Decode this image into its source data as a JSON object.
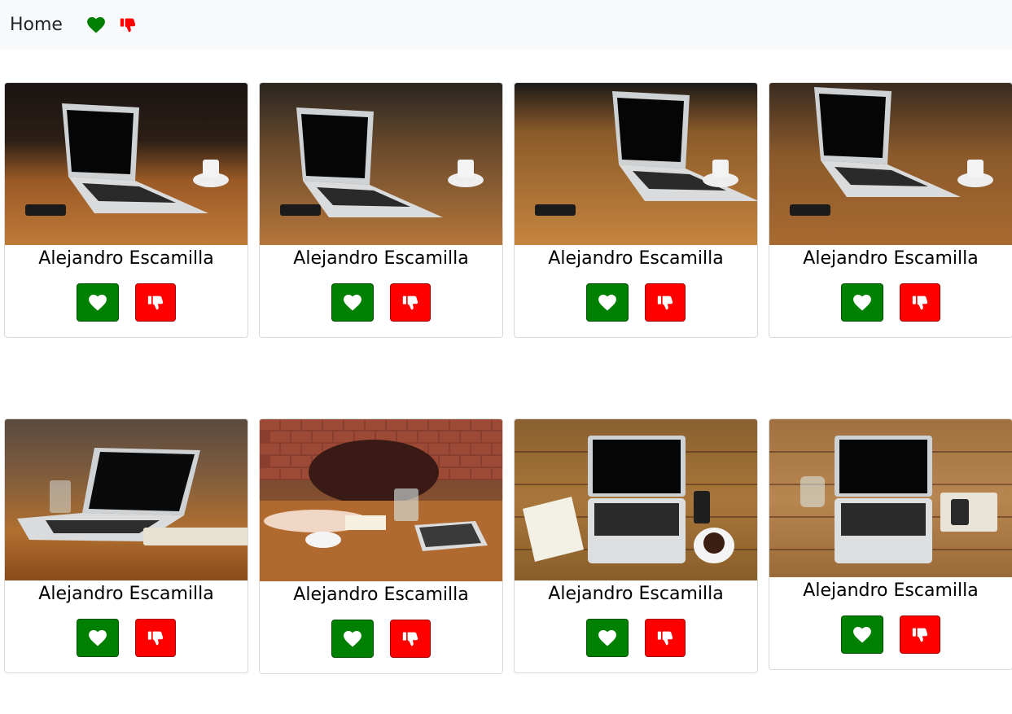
{
  "navbar": {
    "home_label": "Home",
    "like_icon": "heart-icon",
    "dislike_icon": "thumbs-down-icon",
    "like_color": "#008000",
    "dislike_color": "#ff0000"
  },
  "cards": [
    {
      "author": "Alejandro Escamilla",
      "photo": "laptop-on-wooden-table-with-coffee"
    },
    {
      "author": "Alejandro Escamilla",
      "photo": "person-typing-on-laptop"
    },
    {
      "author": "Alejandro Escamilla",
      "photo": "laptop-with-notebook-and-coffee"
    },
    {
      "author": "Alejandro Escamilla",
      "photo": "person-holding-phone-at-laptop"
    },
    {
      "author": "Alejandro Escamilla",
      "photo": "laptop-on-table-with-glass"
    },
    {
      "author": "Alejandro Escamilla",
      "photo": "people-at-table-with-bag-and-tablet"
    },
    {
      "author": "Alejandro Escamilla",
      "photo": "top-down-laptop-notebook-coffee"
    },
    {
      "author": "Alejandro Escamilla",
      "photo": "top-down-laptop-glass-phone"
    }
  ]
}
